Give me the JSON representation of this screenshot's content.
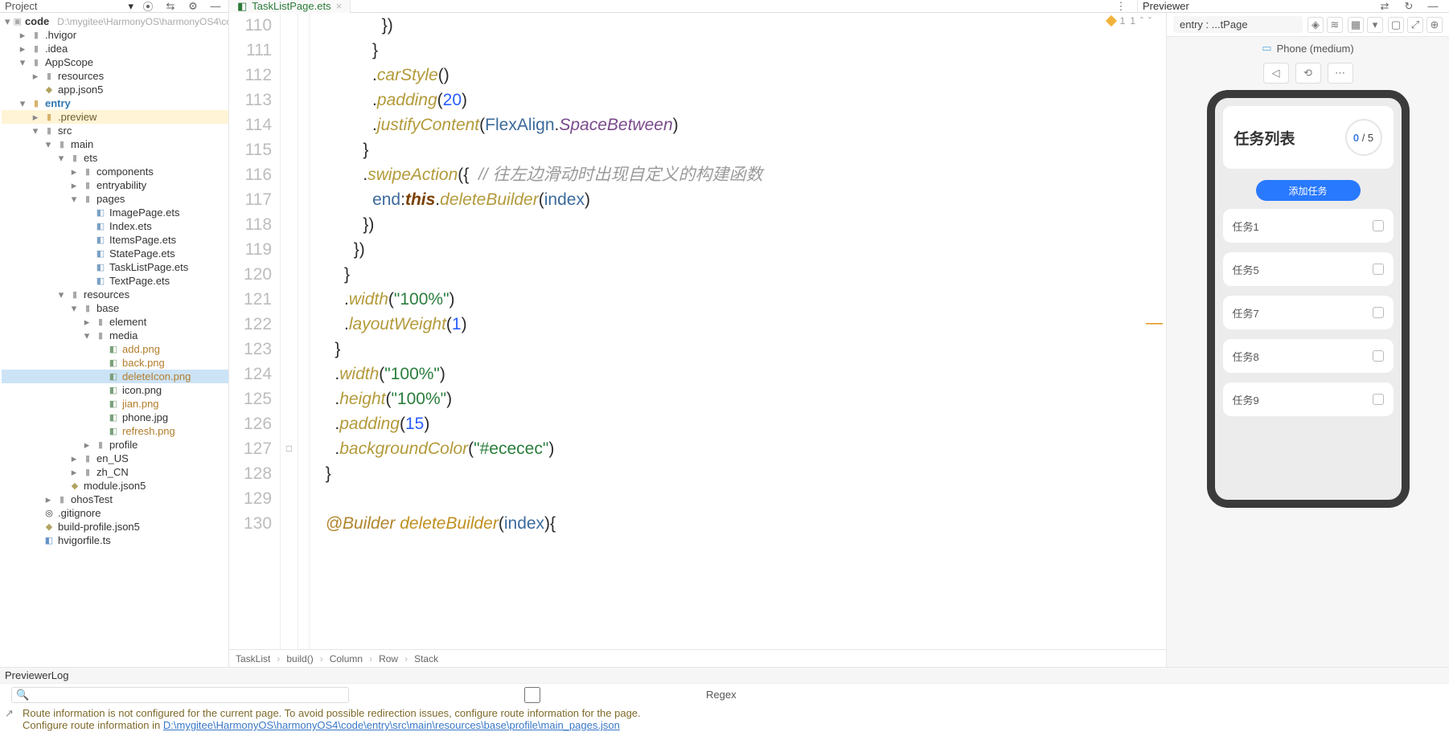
{
  "panel_titles": {
    "project": "Project",
    "previewer": "Previewer",
    "log": "PreviewerLog"
  },
  "file_tab": {
    "name": "TaskListPage.ets"
  },
  "editor_status": {
    "warn_count": "1",
    "err_count": "1"
  },
  "tree": {
    "root": {
      "name": "code",
      "path": "D:\\mygitee\\HarmonyOS\\harmonyOS4\\code"
    },
    "items": {
      "hvigor": ".hvigor",
      "idea": ".idea",
      "appscope": "AppScope",
      "resources": "resources",
      "appjson": "app.json5",
      "entry": "entry",
      "preview": ".preview",
      "src": "src",
      "main": "main",
      "ets": "ets",
      "components": "components",
      "entryability": "entryability",
      "pages": "pages",
      "imagepage": "ImagePage.ets",
      "index": "Index.ets",
      "itemspage": "ItemsPage.ets",
      "statepage": "StatePage.ets",
      "tasklistpage": "TaskListPage.ets",
      "textpage": "TextPage.ets",
      "resources2": "resources",
      "base": "base",
      "element": "element",
      "media": "media",
      "addpng": "add.png",
      "backpng": "back.png",
      "deleteicon": "deleteIcon.png",
      "iconpng": "icon.png",
      "jianpng": "jian.png",
      "phonejpg": "phone.jpg",
      "refreshpng": "refresh.png",
      "profile": "profile",
      "enus": "en_US",
      "zhcn": "zh_CN",
      "modulejson": "module.json5",
      "ohostest": "ohosTest",
      "gitignore": ".gitignore",
      "buildprofile": "build-profile.json5",
      "hvigorfile": "hvigorfile.ts"
    }
  },
  "code_lines": [
    {
      "n": "110",
      "html": "              })"
    },
    {
      "n": "111",
      "html": "            }"
    },
    {
      "n": "112",
      "html": "            .<span class='t-method'>carStyle</span>()"
    },
    {
      "n": "113",
      "html": "            .<span class='t-method'>padding</span>(<span class='t-num'>20</span>)"
    },
    {
      "n": "114",
      "html": "            .<span class='t-method'>justifyContent</span>(<span class='t-sym'>FlexAlign</span>.<span class='t-id'>SpaceBetween</span>)"
    },
    {
      "n": "115",
      "html": "          }"
    },
    {
      "n": "116",
      "html": "          .<span class='t-method'>swipeAction</span>({  <span class='t-comment'>// 往左边滑动时出现自定义的构建函数</span>"
    },
    {
      "n": "117",
      "html": "            <span class='t-sym'>end</span>:<span class='t-kw'>this</span>.<span class='t-method'>deleteBuilder</span>(<span class='t-sym'>index</span>)"
    },
    {
      "n": "118",
      "html": "          })"
    },
    {
      "n": "119",
      "html": "        })"
    },
    {
      "n": "120",
      "html": "      }"
    },
    {
      "n": "121",
      "html": "      .<span class='t-method'>width</span>(<span class='t-str'>\"100%\"</span>)"
    },
    {
      "n": "122",
      "html": "      .<span class='t-method'>layoutWeight</span>(<span class='t-num'>1</span>)",
      "mark": "orange"
    },
    {
      "n": "123",
      "html": "    }"
    },
    {
      "n": "124",
      "html": "    .<span class='t-method'>width</span>(<span class='t-str'>\"100%\"</span>)"
    },
    {
      "n": "125",
      "html": "    .<span class='t-method'>height</span>(<span class='t-str'>\"100%\"</span>)"
    },
    {
      "n": "126",
      "html": "    .<span class='t-method'>padding</span>(<span class='t-num'>15</span>)"
    },
    {
      "n": "127",
      "html": "    .<span class='t-method'>backgroundColor</span>(<span class='t-str'>\"#ececec\"</span>)",
      "bp": "□"
    },
    {
      "n": "128",
      "html": "  }"
    },
    {
      "n": "129",
      "html": ""
    },
    {
      "n": "130",
      "html": "  <span class='t-decor'>@Builder</span> <span class='t-func'>deleteBuilder</span>(<span class='t-sym'>index</span>){"
    }
  ],
  "breadcrumb": [
    "TaskList",
    "build()",
    "Column",
    "Row",
    "Stack"
  ],
  "previewer": {
    "entry": "entry : ...tPage",
    "device": "Phone (medium)",
    "title": "任务列表",
    "progress": {
      "done": "0",
      "total": "5"
    },
    "add_label": "添加任务",
    "tasks": [
      "任务1",
      "任务5",
      "任务7",
      "任务8",
      "任务9"
    ]
  },
  "log": {
    "search_placeholder": "",
    "regex_label": "Regex",
    "line1": "Route information is not configured for the current page. To avoid possible redirection issues, configure route information for the page.",
    "line2_prefix": "Configure route information in ",
    "line2_link": "D:\\mygitee\\HarmonyOS\\harmonyOS4\\code\\entry\\src\\main\\resources\\base\\profile\\main_pages.json"
  }
}
